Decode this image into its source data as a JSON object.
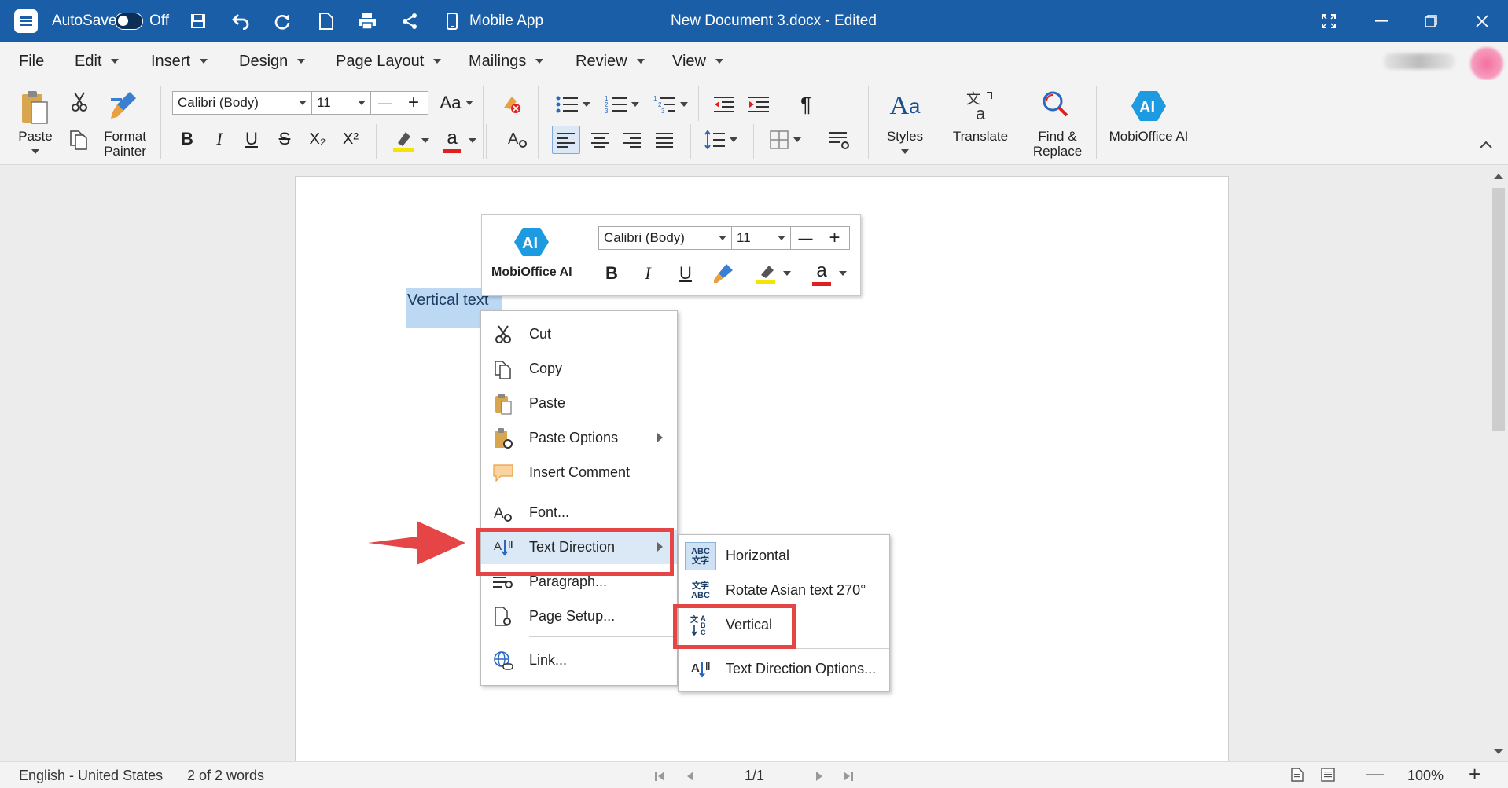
{
  "titlebar": {
    "autosave_label": "AutoSave",
    "autosave_state": "Off",
    "mobile_app_label": "Mobile App",
    "document_title": "New Document 3.docx - Edited"
  },
  "menu": {
    "items": [
      "File",
      "Edit",
      "Insert",
      "Design",
      "Page Layout",
      "Mailings",
      "Review",
      "View"
    ]
  },
  "ribbon": {
    "paste_label": "Paste",
    "format_painter_label_1": "Format",
    "format_painter_label_2": "Painter",
    "font_name": "Calibri (Body)",
    "font_size": "11",
    "styles_label": "Styles",
    "translate_label": "Translate",
    "find_replace_label_1": "Find &",
    "find_replace_label_2": "Replace",
    "mobioffice_ai_label": "MobiOffice AI",
    "bold": "B",
    "italic": "I",
    "underline": "U",
    "strike": "S",
    "subscript": "X₂",
    "superscript": "X²",
    "change_case": "Aa",
    "font_color_glyph": "a",
    "pilcrow": "¶",
    "minus": "—",
    "plus": "+",
    "highlight_color": "#f5e400",
    "font_color": "#e02020"
  },
  "document": {
    "selected_text": "Vertical text"
  },
  "mini_toolbar": {
    "ai_label": "MobiOffice AI",
    "ai_badge": "AI",
    "font_name": "Calibri (Body)",
    "font_size": "11",
    "bold": "B",
    "italic": "I",
    "underline": "U",
    "minus": "—",
    "plus": "+",
    "font_color_glyph": "a"
  },
  "context_menu": {
    "items": [
      "Cut",
      "Copy",
      "Paste",
      "Paste Options",
      "Insert Comment",
      "Font...",
      "Text Direction",
      "Paragraph...",
      "Page Setup...",
      "Link..."
    ]
  },
  "submenu": {
    "items": [
      "Horizontal",
      "Rotate Asian text 270°",
      "Vertical",
      "Text Direction Options..."
    ]
  },
  "statusbar": {
    "language": "English - United States",
    "word_count": "2 of 2 words",
    "page": "1/1",
    "zoom": "100%"
  },
  "colors": {
    "titlebar": "#1a5ea8",
    "selection": "#bcd8f3",
    "highlight_box": "#e64545",
    "ai_badge": "#1e9be0"
  }
}
